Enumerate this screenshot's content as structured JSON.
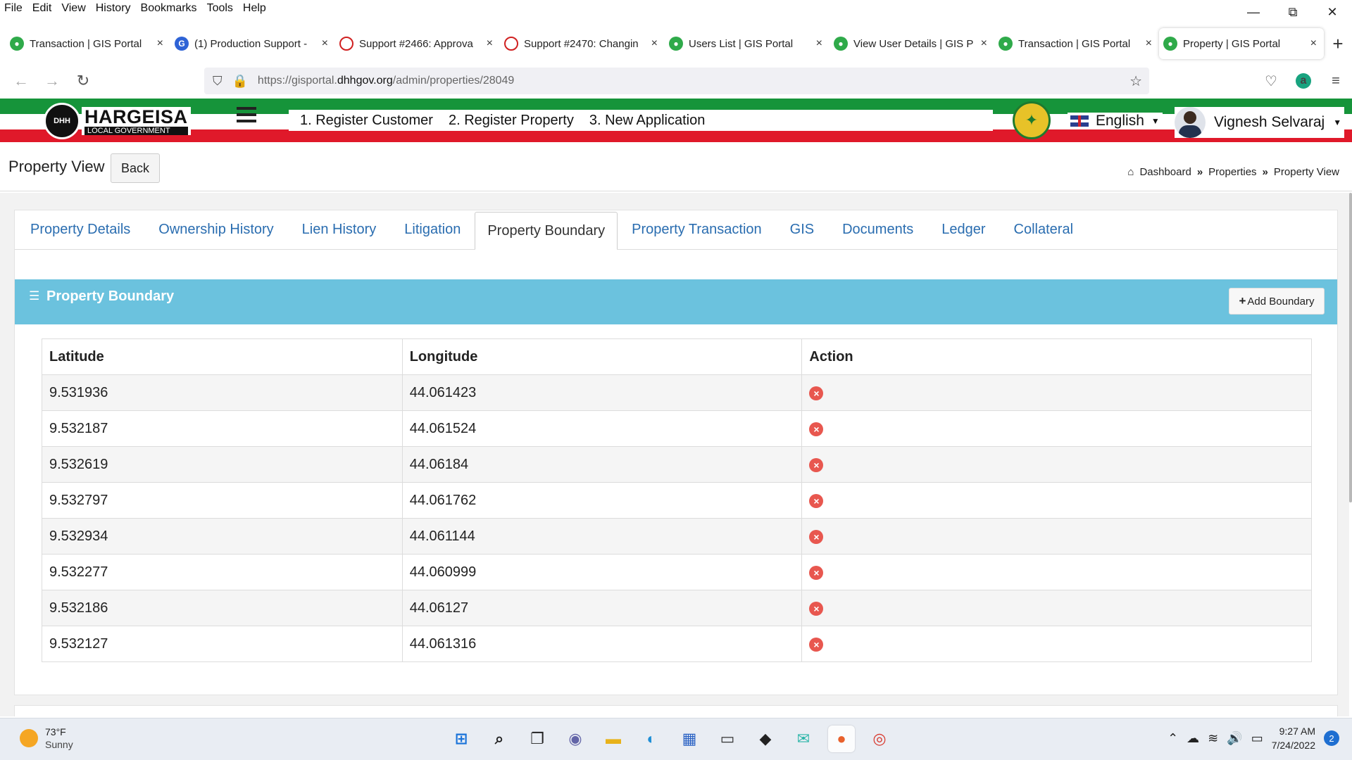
{
  "menubar": [
    "File",
    "Edit",
    "View",
    "History",
    "Bookmarks",
    "Tools",
    "Help"
  ],
  "window_controls": {
    "minimize": "—",
    "restore": "⧉",
    "close": "✕"
  },
  "browser_tabs": [
    {
      "title": "Transaction | GIS Portal",
      "favicon": "gis-icon",
      "close": "×",
      "active": false
    },
    {
      "title": "(1) Production Support -",
      "favicon": "production-icon",
      "close": "×",
      "active": false
    },
    {
      "title": "Support #2466: Approva",
      "favicon": "support-icon",
      "close": "×",
      "active": false
    },
    {
      "title": "Support #2470: Changin",
      "favicon": "support-icon",
      "close": "×",
      "active": false
    },
    {
      "title": "Users List | GIS Portal",
      "favicon": "gis-icon",
      "close": "×",
      "active": false
    },
    {
      "title": "View User Details | GIS P",
      "favicon": "gis-icon",
      "close": "×",
      "active": false
    },
    {
      "title": "Transaction | GIS Portal",
      "favicon": "gis-icon",
      "close": "×",
      "active": false
    },
    {
      "title": "Property | GIS Portal",
      "favicon": "gis-icon",
      "close": "×",
      "active": true
    }
  ],
  "new_tab": "+",
  "address": {
    "prefix": "https://gisportal.",
    "domain": "dhhgov.org",
    "path": "/admin/properties/28049"
  },
  "nav_icons": {
    "back": "←",
    "forward": "→",
    "reload": "↻",
    "shield": "⛉",
    "lock": "🔒",
    "star": "☆",
    "pocket": "♡",
    "account": "a",
    "menu": "≡"
  },
  "app": {
    "logo": {
      "seal": "DHH",
      "name": "HARGEISA",
      "sub": "LOCAL GOVERNMENT"
    },
    "top_links": [
      "1. Register Customer",
      "2. Register Property",
      "3. New Application"
    ],
    "language": "English",
    "user": "Vignesh Selvaraj"
  },
  "page": {
    "title": "Property View",
    "back_label": "Back",
    "breadcrumb": [
      "Dashboard",
      "Properties",
      "Property View"
    ],
    "breadcrumb_sep": "»"
  },
  "tabs": [
    {
      "label": "Property Details",
      "active": false
    },
    {
      "label": "Ownership History",
      "active": false
    },
    {
      "label": "Lien History",
      "active": false
    },
    {
      "label": "Litigation",
      "active": false
    },
    {
      "label": "Property Boundary",
      "active": true
    },
    {
      "label": "Property Transaction",
      "active": false
    },
    {
      "label": "GIS",
      "active": false
    },
    {
      "label": "Documents",
      "active": false
    },
    {
      "label": "Ledger",
      "active": false
    },
    {
      "label": "Collateral",
      "active": false
    }
  ],
  "panel": {
    "title": "Property Boundary",
    "add_button": "Add Boundary",
    "columns": [
      "Latitude",
      "Longitude",
      "Action"
    ],
    "rows": [
      {
        "lat": "9.531936",
        "lng": "44.061423"
      },
      {
        "lat": "9.532187",
        "lng": "44.061524"
      },
      {
        "lat": "9.532619",
        "lng": "44.06184"
      },
      {
        "lat": "9.532797",
        "lng": "44.061762"
      },
      {
        "lat": "9.532934",
        "lng": "44.061144"
      },
      {
        "lat": "9.532277",
        "lng": "44.060999"
      },
      {
        "lat": "9.532186",
        "lng": "44.06127"
      },
      {
        "lat": "9.532127",
        "lng": "44.061316"
      }
    ],
    "delete_glyph": "×"
  },
  "taskbar": {
    "weather_temp": "73°F",
    "weather_cond": "Sunny",
    "apps": [
      {
        "name": "start-icon",
        "glyph": "⊞",
        "color": "#1a73d9"
      },
      {
        "name": "search-icon",
        "glyph": "⌕",
        "color": "#222222"
      },
      {
        "name": "task-view-icon",
        "glyph": "❐",
        "color": "#222222"
      },
      {
        "name": "teams-chat-icon",
        "glyph": "◉",
        "color": "#6264a7"
      },
      {
        "name": "file-explorer-icon",
        "glyph": "▬",
        "color": "#e8b21a"
      },
      {
        "name": "edge-icon",
        "glyph": "◐",
        "color": "#1f8fd6"
      },
      {
        "name": "store-icon",
        "glyph": "▦",
        "color": "#2a62c4"
      },
      {
        "name": "amazon-icon",
        "glyph": "▭",
        "color": "#333333"
      },
      {
        "name": "dropbox-icon",
        "glyph": "◆",
        "color": "#222222"
      },
      {
        "name": "mail-icon",
        "glyph": "✉",
        "color": "#2bb5a8"
      },
      {
        "name": "firefox-icon",
        "glyph": "●",
        "color": "#e8612c"
      },
      {
        "name": "chrome-icon",
        "glyph": "◎",
        "color": "#d93a2f"
      }
    ],
    "tray_icons": [
      "⌃",
      "☁",
      "≋",
      "🔊",
      "▭"
    ],
    "time": "9:27 AM",
    "date": "7/24/2022",
    "notifications": "2"
  }
}
